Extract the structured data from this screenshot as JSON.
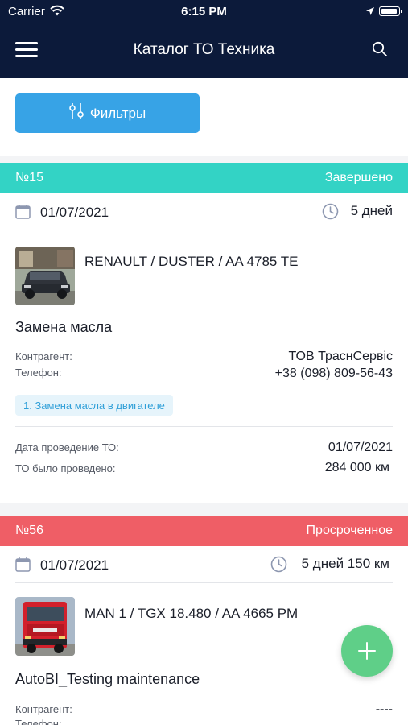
{
  "status_bar": {
    "carrier": "Carrier",
    "time": "6:15 PM"
  },
  "header": {
    "title": "Каталог ТО Техника"
  },
  "filters": {
    "label": "Фильтры"
  },
  "cards": [
    {
      "number": "№15",
      "status": "Завершено",
      "status_color": "#33d3c5",
      "date": "01/07/2021",
      "interval": "5 дней",
      "vehicle": "RENAULT / DUSTER / AA 4785 TE",
      "job": "Замена масла",
      "counterparty_label": "Контрагент:",
      "counterparty": "ТОВ ТраснСервіс",
      "phone_label": "Телефон:",
      "phone": "+38 (098) 809-56-43",
      "tag": "1. Замена масла в двигателе",
      "service_date_label": "Дата проведение ТО:",
      "service_date": "01/07/2021",
      "mileage_label": "ТО было проведено:",
      "mileage": "284 000 км"
    },
    {
      "number": "№56",
      "status": "Просроченное",
      "status_color": "#ef5e66",
      "date": "01/07/2021",
      "interval": "5 дней 150 км",
      "vehicle": "MAN 1 / TGX 18.480 / AA 4665 PM",
      "job": "AutoBI_Testing maintenance",
      "counterparty_label": "Контрагент:",
      "counterparty": "----",
      "phone_label": "Телефон:"
    }
  ],
  "colors": {
    "header_bg": "#0c1a3a",
    "accent_blue": "#37a3e6",
    "fab_green": "#5fcf88"
  },
  "icons": [
    "wifi-icon",
    "location-arrow-icon",
    "battery-icon",
    "menu-icon",
    "search-icon",
    "filter-sliders-icon",
    "calendar-icon",
    "clock-icon",
    "plus-icon"
  ]
}
